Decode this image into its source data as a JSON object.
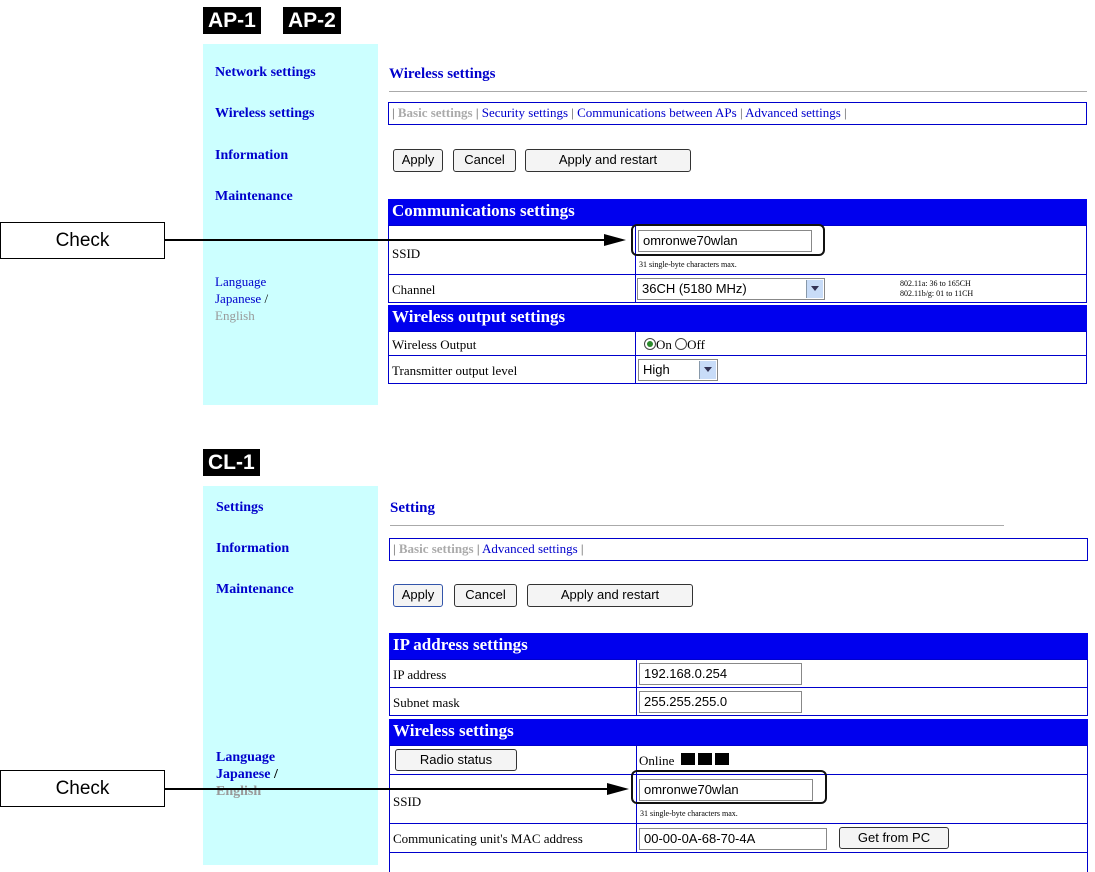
{
  "ap_panel": {
    "badges": [
      "AP-1",
      "AP-2"
    ],
    "sidebar": {
      "items": [
        "Network settings",
        "Wireless settings",
        "Information",
        "Maintenance"
      ],
      "language_label": "Language",
      "japanese": "Japanese",
      "slash": " /",
      "english": "English"
    },
    "heading": "Wireless settings",
    "tabs": {
      "current": "Basic settings",
      "links": [
        "Security settings",
        "Communications between APs",
        "Advanced settings"
      ]
    },
    "buttons": {
      "apply": "Apply",
      "cancel": "Cancel",
      "apply_restart": "Apply and restart"
    },
    "sections": {
      "comm": "Communications settings",
      "output": "Wireless output settings"
    },
    "ssid": {
      "label": "SSID",
      "value": "omronwe70wlan",
      "hint": "31 single-byte characters max."
    },
    "channel": {
      "label": "Channel",
      "selected": "36CH (5180 MHz)",
      "note_a": "802.11a: 36 to 165CH",
      "note_bg": "802.11b/g: 01 to 11CH"
    },
    "wireless_output": {
      "label": "Wireless Output",
      "on": "On",
      "off": "Off",
      "selected": "On"
    },
    "tx_level": {
      "label": "Transmitter output level",
      "selected": "High"
    }
  },
  "cl_panel": {
    "badge": "CL-1",
    "sidebar": {
      "items": [
        "Settings",
        "Information",
        "Maintenance"
      ],
      "language_label": "Language",
      "japanese": "Japanese",
      "slash": " /",
      "english": "English"
    },
    "heading": "Setting",
    "tabs": {
      "current": "Basic settings",
      "links": [
        "Advanced settings"
      ]
    },
    "buttons": {
      "apply": "Apply",
      "cancel": "Cancel",
      "apply_restart": "Apply and restart"
    },
    "sections": {
      "ip": "IP address settings",
      "wireless": "Wireless settings"
    },
    "ip_address": {
      "label": "IP address",
      "value": "192.168.0.254"
    },
    "subnet": {
      "label": "Subnet mask",
      "value": "255.255.255.0"
    },
    "radio_status": {
      "button": "Radio status",
      "state": "Online"
    },
    "ssid": {
      "label": "SSID",
      "value": "omronwe70wlan",
      "hint": "31 single-byte characters max."
    },
    "mac": {
      "label": "Communicating unit's MAC address",
      "value": "00-00-0A-68-70-4A",
      "button": "Get from PC"
    }
  },
  "annotations": {
    "check_label": "Check"
  },
  "colors": {
    "sidebar": "#ccffff",
    "section_header": "#0000ee",
    "link": "#0000cc"
  }
}
